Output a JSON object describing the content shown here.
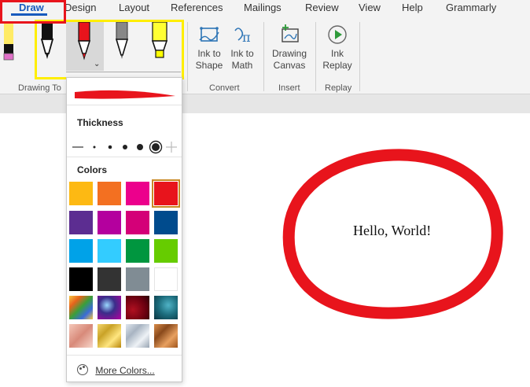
{
  "tabs": [
    {
      "label": "Draw",
      "active": true
    },
    {
      "label": "Design"
    },
    {
      "label": "Layout"
    },
    {
      "label": "References"
    },
    {
      "label": "Mailings"
    },
    {
      "label": "Review"
    },
    {
      "label": "View"
    },
    {
      "label": "Help"
    },
    {
      "label": "Grammarly"
    }
  ],
  "ribbon": {
    "groups": {
      "drawing_tools": "Drawing To",
      "convert": "Convert",
      "insert": "Insert",
      "replay": "Replay"
    },
    "buttons": {
      "ink_to_shape": [
        "Ink to",
        "Shape"
      ],
      "ink_to_math": [
        "Ink to",
        "Math"
      ],
      "drawing_canvas": [
        "Drawing",
        "Canvas"
      ],
      "ink_replay": [
        "Ink",
        "Replay"
      ]
    },
    "pens": [
      {
        "name": "pen-pink",
        "color": "#e070c8"
      },
      {
        "name": "pen-black",
        "color": "#000000"
      },
      {
        "name": "pen-red",
        "color": "#e8141c",
        "selected": true
      },
      {
        "name": "pencil-gray",
        "color": "#666666"
      },
      {
        "name": "highlighter-yellow",
        "color": "#ffff00"
      }
    ]
  },
  "pen_menu": {
    "current_color": "#e8141c",
    "thickness_label": "Thickness",
    "colors_label": "Colors",
    "more_colors_label": "More Colors...",
    "colors": [
      [
        "#fdb913",
        "#f37021",
        "#ec008c",
        "#e8141c"
      ],
      [
        "#5c2d91",
        "#b4009e",
        "#d40078",
        "#004b8d"
      ],
      [
        "#00a2e8",
        "#33ccff",
        "#00963f",
        "#66cc00"
      ],
      [
        "#000000",
        "#333333",
        "#808c94",
        "#ffffff"
      ],
      [
        "texture-rainbow",
        "texture-galaxy",
        "texture-lava",
        "texture-ocean"
      ],
      [
        "texture-rose-gold",
        "texture-gold",
        "texture-silver",
        "texture-bronze"
      ]
    ],
    "selected_color_index": 3
  },
  "document": {
    "text": "Hello, World!",
    "ink_circle_color": "#e8141c"
  },
  "annotations": {
    "highlight_red": "#e8141c",
    "highlight_yellow": "#ffee00"
  }
}
